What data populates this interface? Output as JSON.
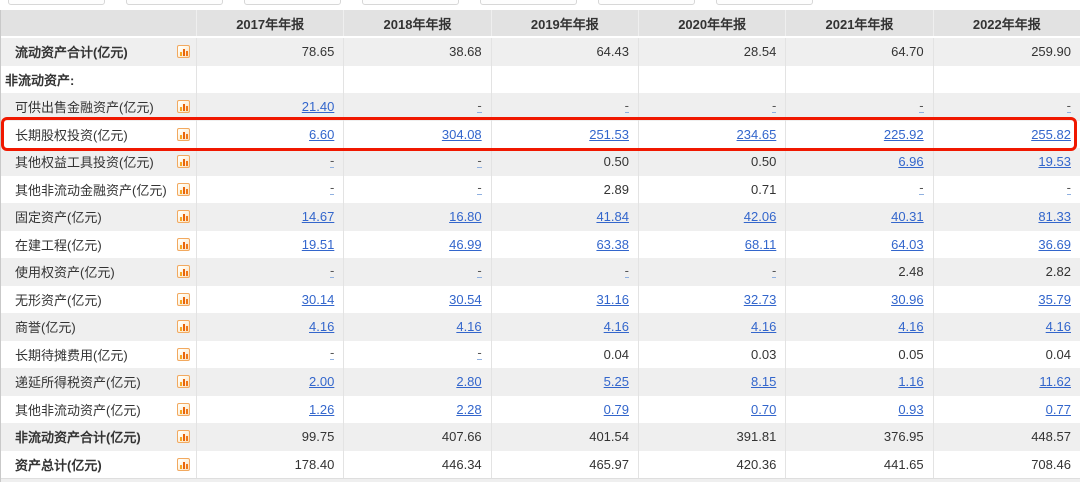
{
  "table": {
    "columns": [
      "2017年年报",
      "2018年年报",
      "2019年年报",
      "2020年年报",
      "2021年年报",
      "2022年年报"
    ],
    "rows": [
      {
        "label": "流动资产合计(亿元)",
        "bold": true,
        "section": false,
        "icon": true,
        "highlight": false,
        "cells": [
          {
            "v": "78.65",
            "t": "plain"
          },
          {
            "v": "38.68",
            "t": "plain"
          },
          {
            "v": "64.43",
            "t": "plain"
          },
          {
            "v": "28.54",
            "t": "plain"
          },
          {
            "v": "64.70",
            "t": "plain"
          },
          {
            "v": "259.90",
            "t": "plain"
          }
        ]
      },
      {
        "label": "非流动资产:",
        "bold": true,
        "section": true,
        "icon": false,
        "highlight": false,
        "cells": [
          {
            "v": "",
            "t": "empty"
          },
          {
            "v": "",
            "t": "empty"
          },
          {
            "v": "",
            "t": "empty"
          },
          {
            "v": "",
            "t": "empty"
          },
          {
            "v": "",
            "t": "empty"
          },
          {
            "v": "",
            "t": "empty"
          }
        ]
      },
      {
        "label": "可供出售金融资产(亿元)",
        "bold": false,
        "section": false,
        "icon": true,
        "highlight": false,
        "cells": [
          {
            "v": "21.40",
            "t": "link"
          },
          {
            "v": "-",
            "t": "dash"
          },
          {
            "v": "-",
            "t": "dash"
          },
          {
            "v": "-",
            "t": "dash"
          },
          {
            "v": "-",
            "t": "dash"
          },
          {
            "v": "-",
            "t": "dash"
          }
        ]
      },
      {
        "label": "长期股权投资(亿元)",
        "bold": false,
        "section": false,
        "icon": true,
        "highlight": true,
        "cells": [
          {
            "v": "6.60",
            "t": "link"
          },
          {
            "v": "304.08",
            "t": "link"
          },
          {
            "v": "251.53",
            "t": "link"
          },
          {
            "v": "234.65",
            "t": "link"
          },
          {
            "v": "225.92",
            "t": "link"
          },
          {
            "v": "255.82",
            "t": "link"
          }
        ]
      },
      {
        "label": "其他权益工具投资(亿元)",
        "bold": false,
        "section": false,
        "icon": true,
        "highlight": false,
        "cells": [
          {
            "v": "-",
            "t": "dash"
          },
          {
            "v": "-",
            "t": "dash"
          },
          {
            "v": "0.50",
            "t": "plain"
          },
          {
            "v": "0.50",
            "t": "plain"
          },
          {
            "v": "6.96",
            "t": "link"
          },
          {
            "v": "19.53",
            "t": "link"
          }
        ]
      },
      {
        "label": "其他非流动金融资产(亿元)",
        "bold": false,
        "section": false,
        "icon": true,
        "highlight": false,
        "cells": [
          {
            "v": "-",
            "t": "dash"
          },
          {
            "v": "-",
            "t": "dash"
          },
          {
            "v": "2.89",
            "t": "plain"
          },
          {
            "v": "0.71",
            "t": "plain"
          },
          {
            "v": "-",
            "t": "dash"
          },
          {
            "v": "-",
            "t": "dash"
          }
        ]
      },
      {
        "label": "固定资产(亿元)",
        "bold": false,
        "section": false,
        "icon": true,
        "highlight": false,
        "cells": [
          {
            "v": "14.67",
            "t": "link"
          },
          {
            "v": "16.80",
            "t": "link"
          },
          {
            "v": "41.84",
            "t": "link"
          },
          {
            "v": "42.06",
            "t": "link"
          },
          {
            "v": "40.31",
            "t": "link"
          },
          {
            "v": "81.33",
            "t": "link"
          }
        ]
      },
      {
        "label": "在建工程(亿元)",
        "bold": false,
        "section": false,
        "icon": true,
        "highlight": false,
        "cells": [
          {
            "v": "19.51",
            "t": "link"
          },
          {
            "v": "46.99",
            "t": "link"
          },
          {
            "v": "63.38",
            "t": "link"
          },
          {
            "v": "68.11",
            "t": "link"
          },
          {
            "v": "64.03",
            "t": "link"
          },
          {
            "v": "36.69",
            "t": "link"
          }
        ]
      },
      {
        "label": "使用权资产(亿元)",
        "bold": false,
        "section": false,
        "icon": true,
        "highlight": false,
        "cells": [
          {
            "v": "-",
            "t": "dash"
          },
          {
            "v": "-",
            "t": "dash"
          },
          {
            "v": "-",
            "t": "dash"
          },
          {
            "v": "-",
            "t": "dash"
          },
          {
            "v": "2.48",
            "t": "plain"
          },
          {
            "v": "2.82",
            "t": "plain"
          }
        ]
      },
      {
        "label": "无形资产(亿元)",
        "bold": false,
        "section": false,
        "icon": true,
        "highlight": false,
        "cells": [
          {
            "v": "30.14",
            "t": "link"
          },
          {
            "v": "30.54",
            "t": "link"
          },
          {
            "v": "31.16",
            "t": "link"
          },
          {
            "v": "32.73",
            "t": "link"
          },
          {
            "v": "30.96",
            "t": "link"
          },
          {
            "v": "35.79",
            "t": "link"
          }
        ]
      },
      {
        "label": "商誉(亿元)",
        "bold": false,
        "section": false,
        "icon": true,
        "highlight": false,
        "cells": [
          {
            "v": "4.16",
            "t": "link"
          },
          {
            "v": "4.16",
            "t": "link"
          },
          {
            "v": "4.16",
            "t": "link"
          },
          {
            "v": "4.16",
            "t": "link"
          },
          {
            "v": "4.16",
            "t": "link"
          },
          {
            "v": "4.16",
            "t": "link"
          }
        ]
      },
      {
        "label": "长期待摊费用(亿元)",
        "bold": false,
        "section": false,
        "icon": true,
        "highlight": false,
        "cells": [
          {
            "v": "-",
            "t": "dash"
          },
          {
            "v": "-",
            "t": "dash"
          },
          {
            "v": "0.04",
            "t": "plain"
          },
          {
            "v": "0.03",
            "t": "plain"
          },
          {
            "v": "0.05",
            "t": "plain"
          },
          {
            "v": "0.04",
            "t": "plain"
          }
        ]
      },
      {
        "label": "递延所得税资产(亿元)",
        "bold": false,
        "section": false,
        "icon": true,
        "highlight": false,
        "cells": [
          {
            "v": "2.00",
            "t": "link"
          },
          {
            "v": "2.80",
            "t": "link"
          },
          {
            "v": "5.25",
            "t": "link"
          },
          {
            "v": "8.15",
            "t": "link"
          },
          {
            "v": "1.16",
            "t": "link"
          },
          {
            "v": "11.62",
            "t": "link"
          }
        ]
      },
      {
        "label": "其他非流动资产(亿元)",
        "bold": false,
        "section": false,
        "icon": true,
        "highlight": false,
        "cells": [
          {
            "v": "1.26",
            "t": "link"
          },
          {
            "v": "2.28",
            "t": "link"
          },
          {
            "v": "0.79",
            "t": "link"
          },
          {
            "v": "0.70",
            "t": "link"
          },
          {
            "v": "0.93",
            "t": "link"
          },
          {
            "v": "0.77",
            "t": "link"
          }
        ]
      },
      {
        "label": "非流动资产合计(亿元)",
        "bold": true,
        "section": false,
        "icon": true,
        "highlight": false,
        "cells": [
          {
            "v": "99.75",
            "t": "plain"
          },
          {
            "v": "407.66",
            "t": "plain"
          },
          {
            "v": "401.54",
            "t": "plain"
          },
          {
            "v": "391.81",
            "t": "plain"
          },
          {
            "v": "376.95",
            "t": "plain"
          },
          {
            "v": "448.57",
            "t": "plain"
          }
        ]
      },
      {
        "label": "资产总计(亿元)",
        "bold": true,
        "section": false,
        "icon": true,
        "highlight": false,
        "cells": [
          {
            "v": "178.40",
            "t": "plain"
          },
          {
            "v": "446.34",
            "t": "plain"
          },
          {
            "v": "465.97",
            "t": "plain"
          },
          {
            "v": "420.36",
            "t": "plain"
          },
          {
            "v": "441.65",
            "t": "plain"
          },
          {
            "v": "708.46",
            "t": "plain"
          }
        ]
      }
    ],
    "unit_note": "亿元",
    "dash_placeholder": "-"
  },
  "icons": {
    "row_icon": "bar-chart-icon"
  },
  "colors": {
    "accent_red": "#f01800",
    "link_blue": "#3366cc",
    "icon_orange": "#f07818",
    "header_bg": "#e2e2e2",
    "row_shade": "#efefef"
  }
}
